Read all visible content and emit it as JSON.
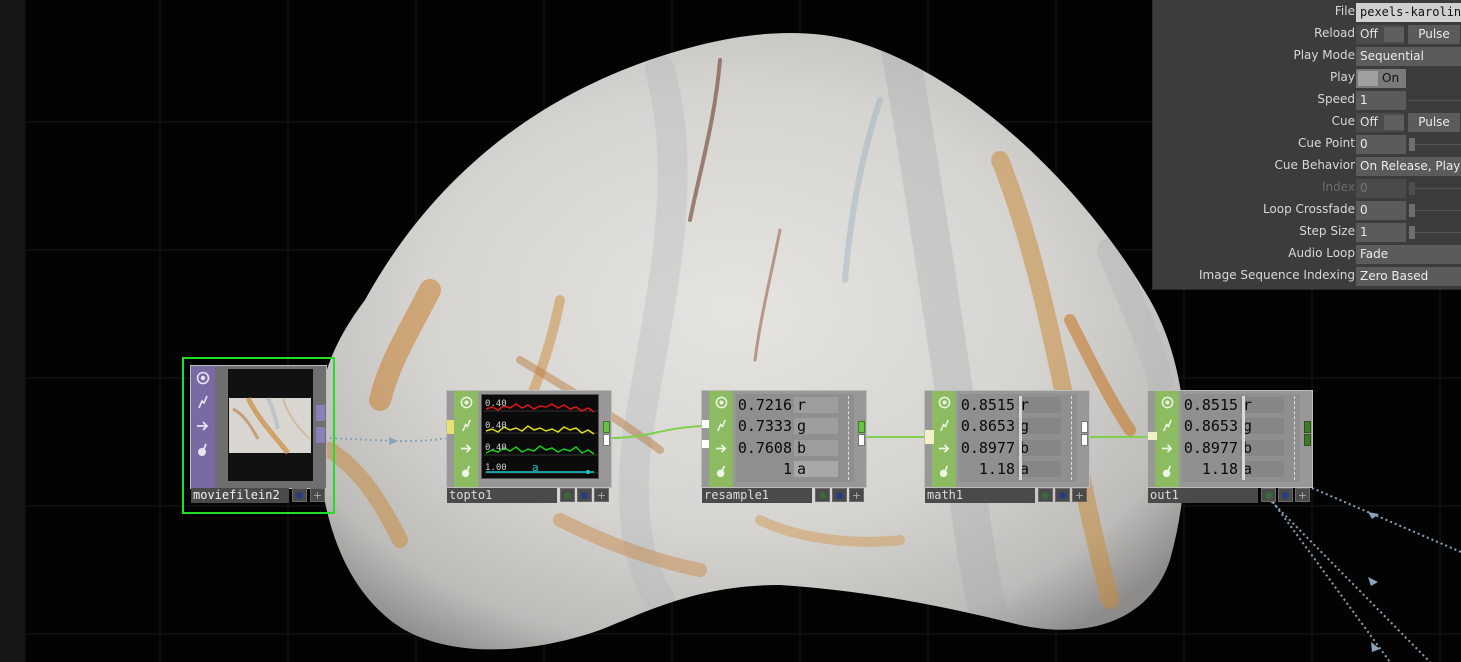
{
  "app": {
    "name": "TouchDesigner network editor"
  },
  "colors": {
    "chop_flag_green": "#8cbb62",
    "top_flag_purple": "#7a6aa4",
    "selected_outline": "#22dd22",
    "wire_green": "#7fd04a",
    "wire_dotted": "#8aa3b8"
  },
  "params": {
    "file": {
      "label": "File",
      "value": "pexels-karolin"
    },
    "reload": {
      "label": "Reload",
      "toggle": "Off",
      "pulse": "Pulse"
    },
    "play_mode": {
      "label": "Play Mode",
      "value": "Sequential"
    },
    "play": {
      "label": "Play",
      "toggle": "On"
    },
    "speed": {
      "label": "Speed",
      "value": "1"
    },
    "cue": {
      "label": "Cue",
      "toggle": "Off",
      "pulse": "Pulse"
    },
    "cue_point": {
      "label": "Cue Point",
      "value": "0"
    },
    "cue_behavior": {
      "label": "Cue Behavior",
      "value": "On Release, Play"
    },
    "index": {
      "label": "Index",
      "value": "0"
    },
    "loop_crossfade": {
      "label": "Loop Crossfade",
      "value": "0"
    },
    "step_size": {
      "label": "Step Size",
      "value": "1"
    },
    "audio_loop": {
      "label": "Audio Loop",
      "value": "Fade"
    },
    "image_seq_indexing": {
      "label": "Image Sequence Indexing",
      "value": "Zero Based"
    }
  },
  "nodes": {
    "moviefilein2": {
      "name": "moviefilein2",
      "type": "TOP",
      "selected": true
    },
    "topto1": {
      "name": "topto1",
      "graph_labels": [
        "0.40",
        "0.40",
        "0.40",
        "1.00",
        "a"
      ],
      "graph_colors": [
        "#e01818",
        "#e0e018",
        "#18d018",
        "#18c8d0"
      ]
    },
    "resample1": {
      "name": "resample1",
      "channels": [
        {
          "name": "r",
          "value": "0.7216"
        },
        {
          "name": "g",
          "value": "0.7333"
        },
        {
          "name": "b",
          "value": "0.7608"
        },
        {
          "name": "a",
          "value": "1"
        }
      ]
    },
    "math1": {
      "name": "math1",
      "channels": [
        {
          "name": "r",
          "value": "0.8515"
        },
        {
          "name": "g",
          "value": "0.8653"
        },
        {
          "name": "b",
          "value": "0.8977"
        },
        {
          "name": "a",
          "value": "1.18"
        }
      ]
    },
    "out1": {
      "name": "out1",
      "channels": [
        {
          "name": "r",
          "value": "0.8515"
        },
        {
          "name": "g",
          "value": "0.8653"
        },
        {
          "name": "b",
          "value": "0.8977"
        },
        {
          "name": "a",
          "value": "1.18"
        }
      ]
    }
  },
  "icons": {
    "viewer_flag": "eye-icon",
    "bypass_flag": "lightning-icon",
    "display_flag": "arrow-right-icon",
    "lock_flag": "lock-icon",
    "add_button": "plus-icon"
  }
}
